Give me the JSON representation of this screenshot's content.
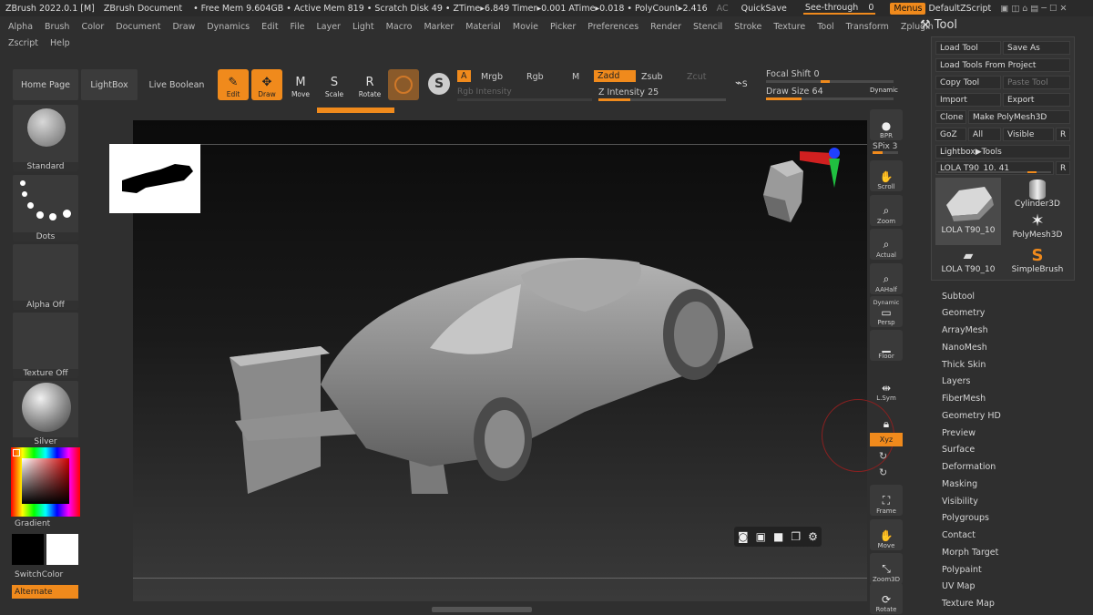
{
  "titlebar": {
    "app": "ZBrush 2022.0.1 [M]",
    "doc": "ZBrush Document",
    "stats": "• Free Mem 9.604GB • Active Mem 819 • Scratch Disk 49 • ZTime▸6.849 Timer▸0.001 ATime▸0.018 • PolyCount▸2.416",
    "ac": "AC",
    "quicksave": "QuickSave",
    "seethrough": "See-through",
    "seethrough_val": "0",
    "menus": "Menus",
    "script": "DefaultZScript"
  },
  "menubar": {
    "row1": [
      "Alpha",
      "Brush",
      "Color",
      "Document",
      "Draw",
      "Dynamics",
      "Edit",
      "File",
      "Layer",
      "Light",
      "Macro",
      "Marker",
      "Material",
      "Movie",
      "Picker",
      "Preferences",
      "Render",
      "Stencil",
      "Stroke",
      "Texture",
      "Tool",
      "Transform",
      "Zplugin"
    ],
    "row2": [
      "Zscript",
      "Help"
    ]
  },
  "shelf": {
    "home": "Home Page",
    "lightbox": "LightBox",
    "liveboolean": "Live Boolean",
    "edit": "Edit",
    "draw": "Draw",
    "move": "Move",
    "scale": "Scale",
    "rotate": "Rotate",
    "a": "A",
    "mrgb": "Mrgb",
    "rgb": "Rgb",
    "m": "M",
    "zadd": "Zadd",
    "zsub": "Zsub",
    "zcut": "Zcut",
    "rgb_intensity": "Rgb Intensity",
    "z_intensity": "Z Intensity",
    "z_intensity_val": "25",
    "focal_shift": "Focal Shift",
    "focal_shift_val": "0",
    "draw_size": "Draw Size",
    "draw_size_val": "64",
    "dynamic": "Dynamic",
    "edit_icon": "edit-pencil-icon",
    "draw_icon": "draw-crosshair-icon",
    "s_label": "S"
  },
  "left": {
    "standard": "Standard",
    "dots": "Dots",
    "alpha": "Alpha Off",
    "texture": "Texture Off",
    "material": "Silver",
    "gradient": "Gradient",
    "switchcolor": "SwitchColor",
    "alternate": "Alternate"
  },
  "right": {
    "bpr": "BPR",
    "spix": "SPix",
    "spix_val": "3",
    "scroll": "Scroll",
    "zoom": "Zoom",
    "actual": "Actual",
    "aahalf": "AAHalf",
    "dynamic": "Dynamic",
    "persp": "Persp",
    "floor": "Floor",
    "lsym": "L.Sym",
    "xyz": "Xyz",
    "frame": "Frame",
    "move": "Move",
    "zoom3d": "Zoom3D",
    "rotate": "Rotate"
  },
  "tool": {
    "title": "Tool",
    "load": "Load Tool",
    "saveas": "Save As",
    "loadproj": "Load Tools From Project",
    "copy": "Copy Tool",
    "paste": "Paste Tool",
    "import": "Import",
    "export": "Export",
    "clone": "Clone",
    "makepoly": "Make PolyMesh3D",
    "goz": "GoZ",
    "all": "All",
    "visible": "Visible",
    "r": "R",
    "lightbox_tools": "Lightbox▶Tools",
    "current": "LOLA T90_10. 41",
    "thumbs": [
      "LOLA T90_10",
      "Cylinder3D",
      "PolyMesh3D",
      "LOLA T90_10",
      "SimpleBrush"
    ]
  },
  "subpalettes": [
    "Subtool",
    "Geometry",
    "ArrayMesh",
    "NanoMesh",
    "Thick Skin",
    "Layers",
    "FiberMesh",
    "Geometry HD",
    "Preview",
    "Surface",
    "Deformation",
    "Masking",
    "Visibility",
    "Polygroups",
    "Contact",
    "Morph Target",
    "Polypaint",
    "UV Map",
    "Texture Map"
  ],
  "colors": {
    "accent": "#f08a1c"
  }
}
